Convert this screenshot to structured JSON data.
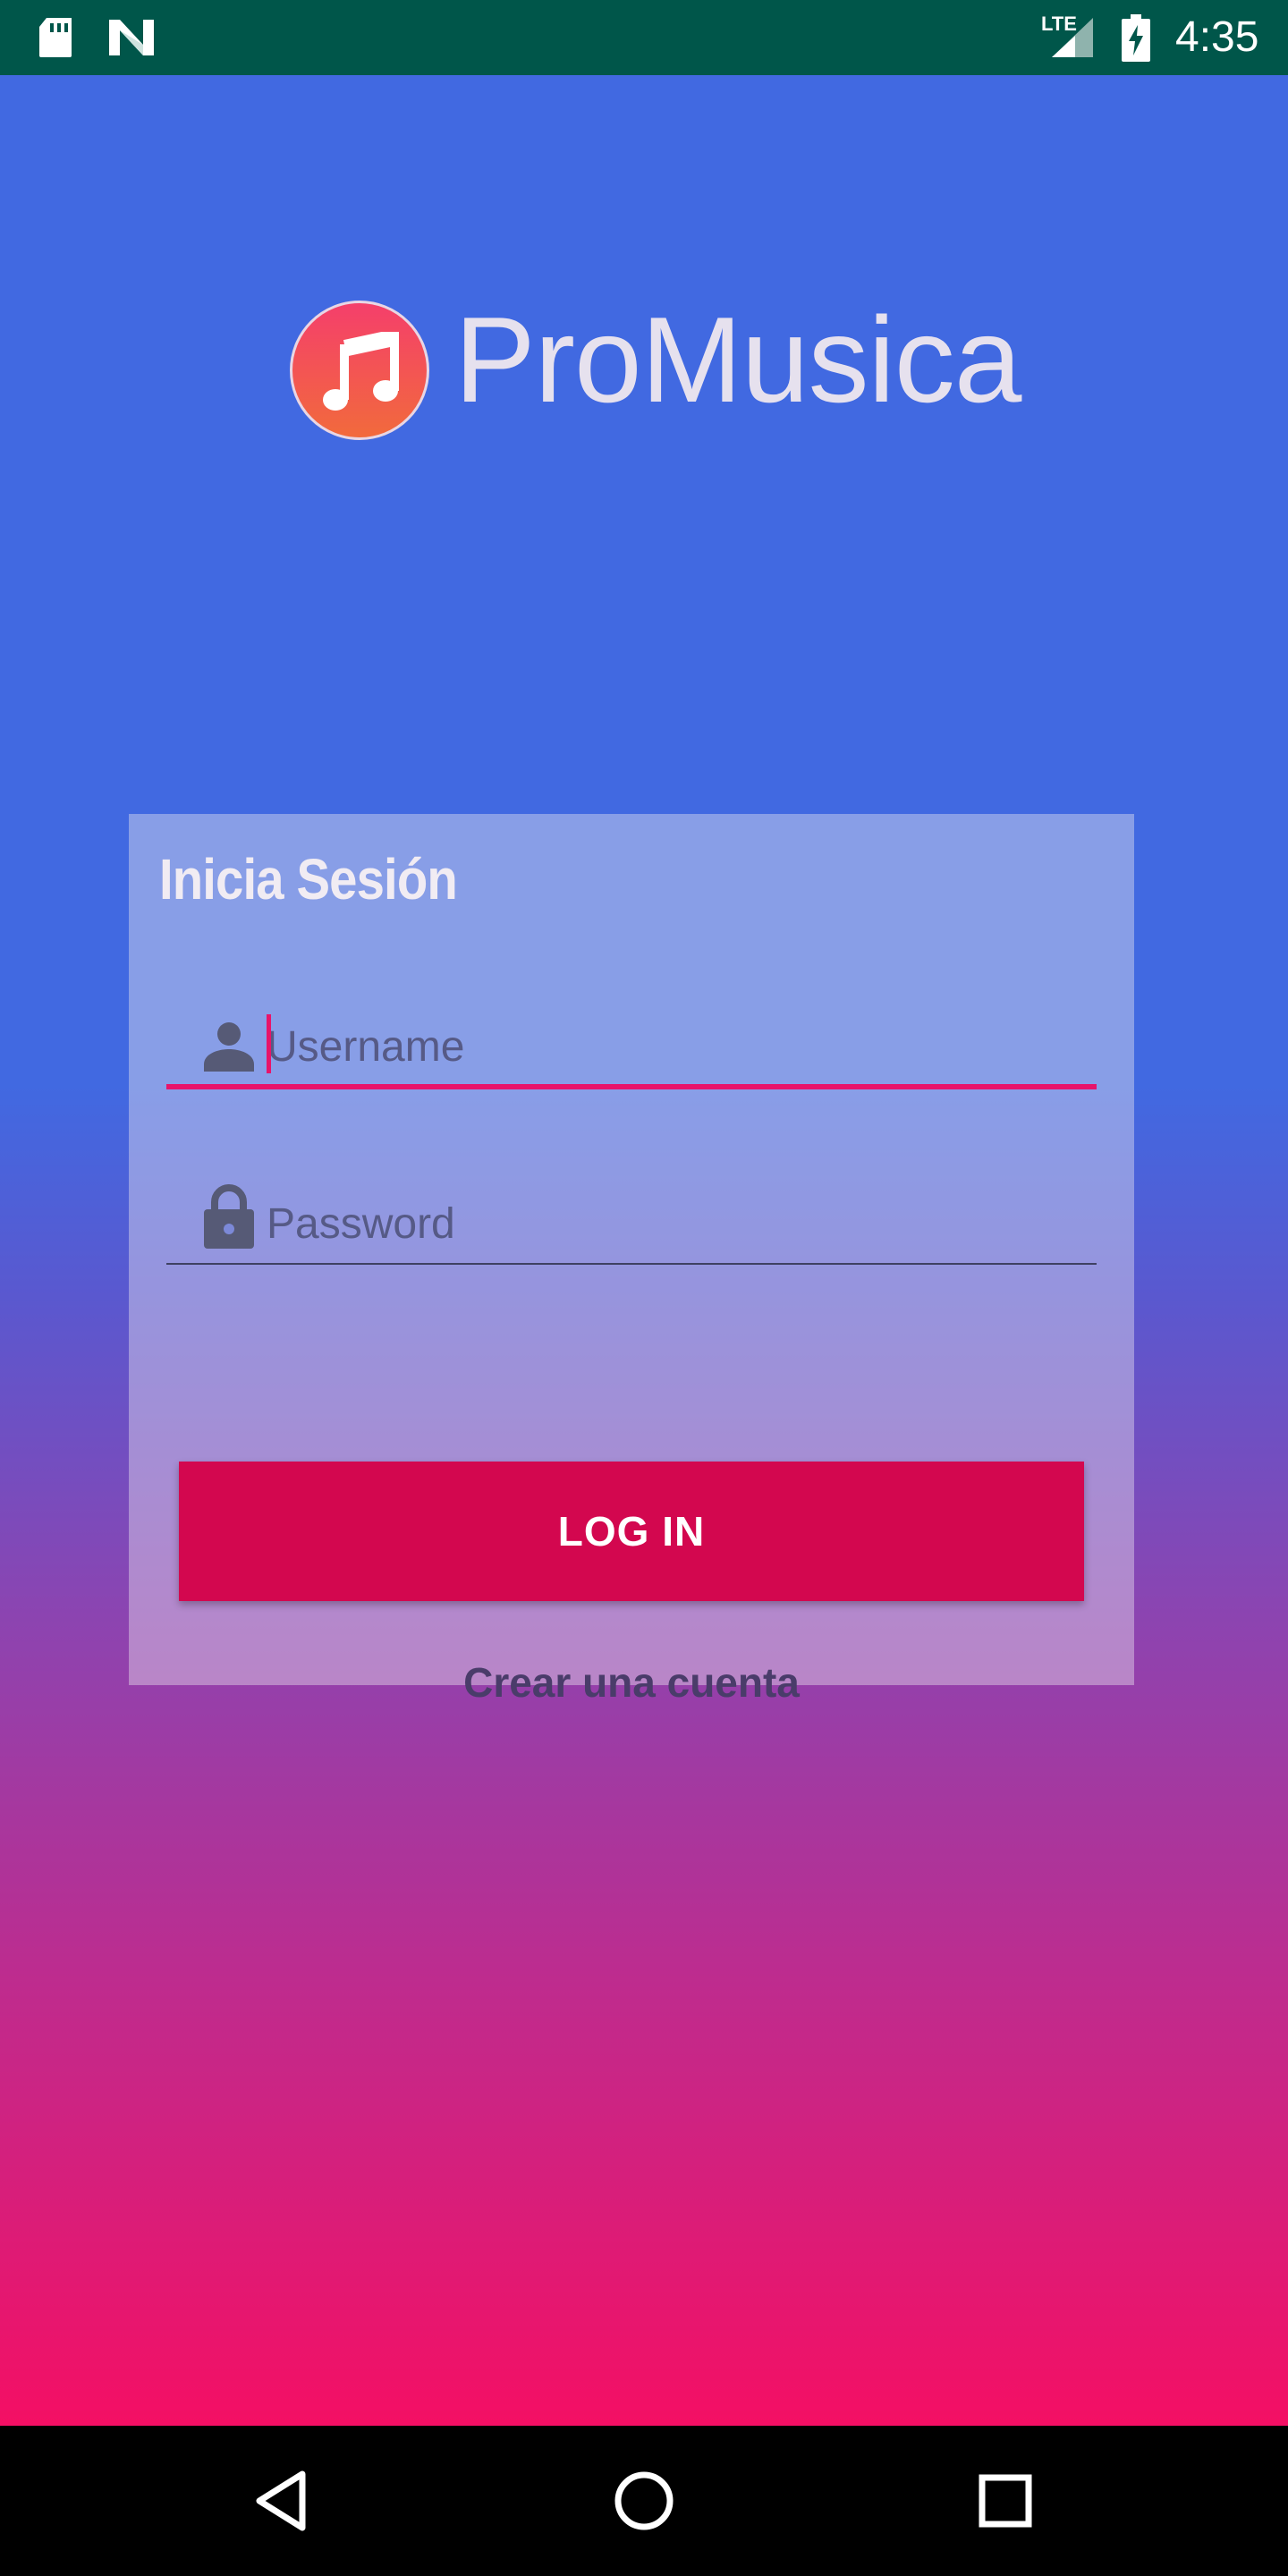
{
  "status_bar": {
    "network_label": "LTE",
    "time": "4:35",
    "icons": [
      "sd-card-icon",
      "n-notification-icon",
      "signal-icon",
      "battery-charging-icon"
    ],
    "background_color": "#00564a"
  },
  "app": {
    "title": "ProMusica",
    "logo_icon": "music-note-icon"
  },
  "login": {
    "heading": "Inicia Sesión",
    "username_placeholder": "Username",
    "password_placeholder": "Password",
    "login_button": "LOG IN",
    "create_account": "Crear una cuenta"
  },
  "nav_bar": {
    "icons": [
      "back-icon",
      "home-icon",
      "recents-icon"
    ]
  },
  "colors": {
    "gradient_top": "#4169e1",
    "gradient_bottom": "#f40f64",
    "accent": "#d3074f",
    "field_focus": "#e8146a"
  }
}
